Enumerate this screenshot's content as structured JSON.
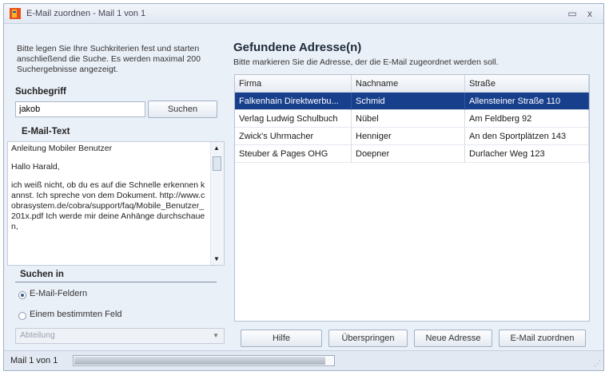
{
  "window": {
    "title": "E-Mail zuordnen - Mail 1 von 1",
    "minimize_label": "▭",
    "close_label": "x"
  },
  "left": {
    "intro": "Bitte legen Sie Ihre Suchkriterien fest und starten anschließend die Suche. Es werden maximal 200 Suchergebnisse angezeigt.",
    "search_label": "Suchbegriff",
    "search_value": "jakob",
    "search_button": "Suchen",
    "mailtext_label": "E-Mail-Text",
    "mailtext_paragraphs": [
      "Anleitung Mobiler Benutzer",
      "Hallo Harald,",
      "ich weiß nicht, ob du es auf die Schnelle erkennen kannst. Ich spreche von dem Dokument. http://www.cobrasystem.de/cobra/support/faq/Mobile_Benutzer_201x.pdf Ich werde mir deine Anhänge durchschauen,"
    ],
    "search_in_label": "Suchen in",
    "radio_options": [
      {
        "label": "E-Mail-Feldern",
        "selected": true
      },
      {
        "label": "Einem bestimmten Feld",
        "selected": false
      }
    ],
    "field_select": "Abteilung"
  },
  "right": {
    "title": "Gefundene Adresse(n)",
    "subtitle": "Bitte markieren Sie die Adresse, der die E-Mail zugeordnet werden soll.",
    "columns": [
      "Firma",
      "Nachname",
      "Straße"
    ],
    "rows": [
      [
        "Falkenhain Direktwerbu...",
        "Schmid",
        "Allensteiner Straße 110"
      ],
      [
        "Verlag Ludwig Schulbuch",
        "Nübel",
        "Am Feldberg 92"
      ],
      [
        "Zwick's Uhrmacher",
        "Henniger",
        "An den Sportplätzen 143"
      ],
      [
        "Steuber & Pages OHG",
        "Doepner",
        "Durlacher Weg 123"
      ]
    ],
    "selected_row": 0,
    "buttons": {
      "help": "Hilfe",
      "skip": "Überspringen",
      "new_address": "Neue Adresse",
      "assign": "E-Mail zuordnen"
    }
  },
  "status": {
    "text": "Mail 1 von 1",
    "progress": 0.97
  },
  "colors": {
    "selection": "#183f8c",
    "window_bg": "#eaf0f8"
  }
}
